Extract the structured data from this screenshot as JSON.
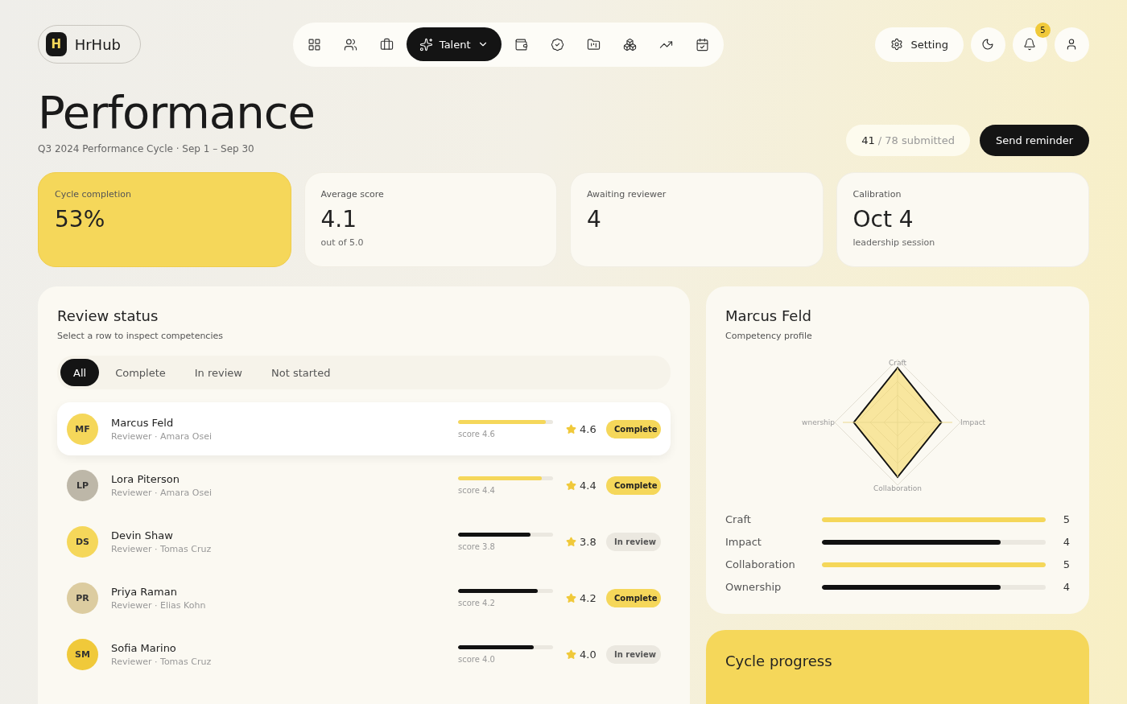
{
  "brand": {
    "logo": "H",
    "name": "HrHub"
  },
  "nav": [
    {
      "selected": false
    },
    {
      "selected": false
    },
    {
      "selected": false
    },
    {
      "label": "Talent",
      "selected": true
    },
    {
      "selected": false
    },
    {
      "selected": false
    },
    {
      "selected": false
    },
    {
      "selected": false
    },
    {
      "selected": false
    },
    {
      "selected": false
    }
  ],
  "header_actions": {
    "setting": "Setting",
    "notifications": "5"
  },
  "page": {
    "title": "Performance",
    "subtitle": "Q3 2024 Performance Cycle · Sep 1 – Sep 30",
    "submitted_count": "41",
    "submitted_total": "/ 78 submitted",
    "reminder_button": "Send reminder"
  },
  "stats": [
    {
      "label": "Cycle completion",
      "value": "53%",
      "highlighted": true
    },
    {
      "label": "Average score",
      "value": "4.1",
      "note": "out of 5.0",
      "highlighted": false
    },
    {
      "label": "Awaiting reviewer",
      "value": "4",
      "highlighted": false
    },
    {
      "label": "Calibration",
      "value": "Oct 4",
      "note": "leadership session",
      "highlighted": false
    }
  ],
  "review_status": {
    "title": "Review status",
    "subtitle": "Select a row to inspect competencies",
    "filters": [
      {
        "label": "All",
        "selected": true
      },
      {
        "label": "Complete",
        "selected": false
      },
      {
        "label": "In review",
        "selected": false
      },
      {
        "label": "Not started",
        "selected": false
      }
    ],
    "rows": [
      {
        "avatar": {
          "initials": "MF",
          "color": "#f5d75a"
        },
        "name": "Marcus Feld",
        "reviewer": "Reviewer · Amara Osei",
        "bar": {
          "level": 0.92,
          "color": "#f5d75a"
        },
        "score_label": "score 4.6",
        "score": "4.6",
        "status": "Complete",
        "kind": "complete",
        "selected": true
      },
      {
        "avatar": {
          "initials": "LP",
          "color": "#bdb7a8"
        },
        "name": "Lora Piterson",
        "reviewer": "Reviewer · Amara Osei",
        "bar": {
          "level": 0.88,
          "color": "#f5d75a"
        },
        "score_label": "score 4.4",
        "score": "4.4",
        "status": "Complete",
        "kind": "complete",
        "selected": false
      },
      {
        "avatar": {
          "initials": "DS",
          "color": "#f5d75a"
        },
        "name": "Devin Shaw",
        "reviewer": "Reviewer · Tomas Cruz",
        "bar": {
          "level": 0.76,
          "color": "#111111"
        },
        "score_label": "score 3.8",
        "score": "3.8",
        "status": "In review",
        "kind": "review",
        "selected": false
      },
      {
        "avatar": {
          "initials": "PR",
          "color": "#dccca0"
        },
        "name": "Priya Raman",
        "reviewer": "Reviewer · Elias Kohn",
        "bar": {
          "level": 0.84,
          "color": "#111111"
        },
        "score_label": "score 4.2",
        "score": "4.2",
        "status": "Complete",
        "kind": "complete",
        "selected": false
      },
      {
        "avatar": {
          "initials": "SM",
          "color": "#f0c93a"
        },
        "name": "Sofia Marino",
        "reviewer": "Reviewer · Tomas Cruz",
        "bar": {
          "level": 0.8,
          "color": "#111111"
        },
        "score_label": "score 4.0",
        "score": "4.0",
        "status": "In review",
        "kind": "review",
        "selected": false
      }
    ]
  },
  "profile": {
    "name": "Marcus Feld",
    "subtitle": "Competency profile",
    "radar_labels": [
      "Craft",
      "Impact",
      "Collaboration",
      "wnership"
    ],
    "competencies": [
      {
        "name": "Craft",
        "level": 1.0,
        "color": "#f5d75a",
        "value": "5"
      },
      {
        "name": "Impact",
        "level": 0.8,
        "color": "#111111",
        "value": "4"
      },
      {
        "name": "Collaboration",
        "level": 1.0,
        "color": "#f5d75a",
        "value": "5"
      },
      {
        "name": "Ownership",
        "level": 0.8,
        "color": "#111111",
        "value": "4"
      }
    ]
  },
  "cycle_progress": {
    "title": "Cycle progress"
  }
}
